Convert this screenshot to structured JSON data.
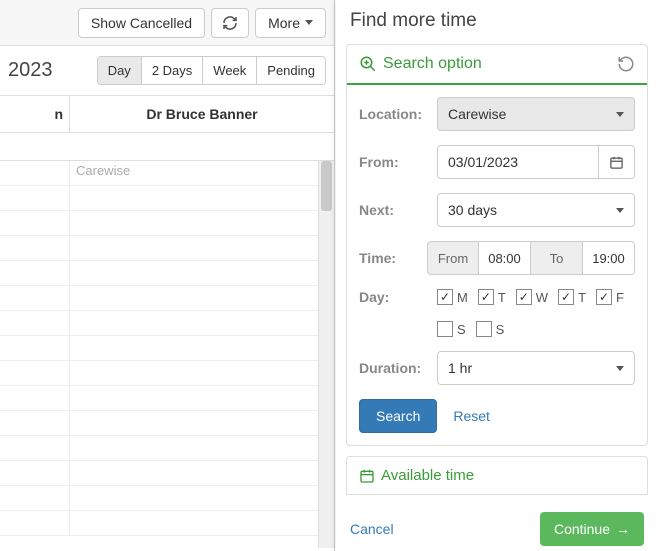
{
  "toolbar": {
    "show_cancelled": "Show Cancelled",
    "more": "More"
  },
  "calendar": {
    "date_partial": "2023",
    "views": {
      "day": "Day",
      "two_days": "2 Days",
      "week": "Week",
      "pending": "Pending"
    },
    "column_partial_left": "n",
    "column_doctor": "Dr Bruce Banner",
    "location_tag": "Carewise"
  },
  "panel": {
    "title": "Find more time",
    "search_option": "Search option"
  },
  "form": {
    "location_label": "Location:",
    "location_value": "Carewise",
    "from_label": "From:",
    "from_value": "03/01/2023",
    "next_label": "Next:",
    "next_value": "30 days",
    "time_label": "Time:",
    "time_from_lbl": "From",
    "time_from_val": "08:00",
    "time_to_lbl": "To",
    "time_to_val": "19:00",
    "day_label": "Day:",
    "days": {
      "m": "M",
      "t1": "T",
      "w": "W",
      "t2": "T",
      "f": "F",
      "s1": "S",
      "s2": "S"
    },
    "duration_label": "Duration:",
    "duration_value": "1 hr",
    "search_btn": "Search",
    "reset_link": "Reset"
  },
  "available": {
    "title": "Available time"
  },
  "footer": {
    "cancel": "Cancel",
    "continue": "Continue"
  }
}
